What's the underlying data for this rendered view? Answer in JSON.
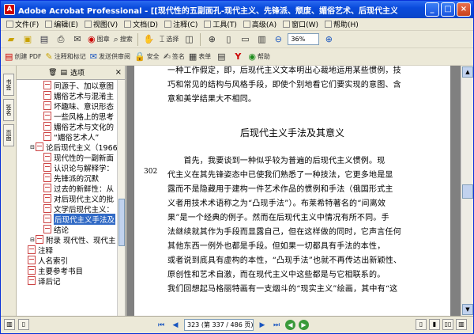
{
  "window": {
    "title": "Adobe Acrobat Professional - [[现代性的五副面孔-现代主义、先锋派、颓废、媚俗艺术、后现代主义].Five.Faces...",
    "min": "_",
    "max": "□",
    "close": "×"
  },
  "menu": [
    "文件(F)",
    "编辑(E)",
    "视图(V)",
    "文档(D)",
    "注释(C)",
    "工具(T)",
    "高级(A)",
    "窗口(W)",
    "帮助(H)"
  ],
  "toolbar1": {
    "find_label": "搜索",
    "read_label": "搜索",
    "zoom": "36%",
    "select_label": "选择"
  },
  "toolbar2": {
    "create_pdf": "创建 PDF",
    "comment_markup": "注释和标记",
    "send_review": "发送供审阅",
    "secure": "安全",
    "sign": "签名",
    "forms": "表单",
    "help": "帮助"
  },
  "nav": {
    "options_label": "选项",
    "left_tabs": [
      "书签",
      "签名",
      "页面"
    ]
  },
  "bookmarks": [
    {
      "label": "同源于、加以意图",
      "indent": 2,
      "sel": false
    },
    {
      "label": "媚俗艺术与混淆主",
      "indent": 2,
      "sel": false
    },
    {
      "label": "坏趣味、意识形态",
      "indent": 2,
      "sel": false
    },
    {
      "label": "一些风格上的思考",
      "indent": 2,
      "sel": false
    },
    {
      "label": "媚俗艺术与文化的",
      "indent": 2,
      "sel": false
    },
    {
      "label": "“媚俗艺术人”",
      "indent": 2,
      "sel": false
    },
    {
      "label": "论后现代主义（1966）",
      "indent": 1,
      "sel": false
    },
    {
      "label": "现代性的一副新面",
      "indent": 2,
      "sel": false
    },
    {
      "label": "认识论与解释学：",
      "indent": 2,
      "sel": false
    },
    {
      "label": "先锋派的沉默",
      "indent": 2,
      "sel": false
    },
    {
      "label": "过去的新鲜性：从",
      "indent": 2,
      "sel": false
    },
    {
      "label": "对后现代主义的批",
      "indent": 2,
      "sel": false
    },
    {
      "label": "文学后现代主义：",
      "indent": 2,
      "sel": false
    },
    {
      "label": "后现代主义手法及",
      "indent": 2,
      "sel": true
    },
    {
      "label": "结论",
      "indent": 2,
      "sel": false
    },
    {
      "label": "附录 现代性、现代主",
      "indent": 1,
      "sel": false
    },
    {
      "label": "注释",
      "indent": 0,
      "sel": false
    },
    {
      "label": "人名索引",
      "indent": 0,
      "sel": false
    },
    {
      "label": "主要参考书目",
      "indent": 0,
      "sel": false
    },
    {
      "label": "译后记",
      "indent": 0,
      "sel": false
    }
  ],
  "page": {
    "top_lines": [
      "一种工作假定，即，后现代主义文本明出心裁地运用某些惯例，技",
      "巧和常见的结构与风格手段，即使个别地看它们要实现的意图、含",
      "意和美学结果大不相同。"
    ],
    "heading": "后现代主义手法及其意义",
    "margin_page_number": "302",
    "body_lines": [
      "　　首先，我要谈到一种似乎较为普遍的后现代主义惯例。现",
      "代主义在其先锋姿态中已使我们熟悉了一种技法，它更多地是显",
      "露而不是隐藏用于建构一件艺术作品的惯例和手法（俄国形式主",
      "义者用技术术语称之为“凸现手法”）。布莱希特著名的“间离效",
      "果”是一个经典的例子。然而在后现代主义中情况有所不同。手",
      "法继续就其作为手段而显露自己，但在这样做的同时，它声言任何",
      "其他东西一例外也都是手段。但如果一切都具有手法的本性，",
      "或者说到底具有虚构的本性，“凸现手法”也就不再传达出新颖性、",
      "原创性和艺术自激，而在现代主义中这些都是与它相联系的。",
      "我们回想起马格丽特画有一支烟斗的“现实主义”绘画，其中有“这"
    ]
  },
  "status": {
    "page_box": "323 (第 337 / 486 页)",
    "first": "⏮",
    "prev": "◀",
    "next": "▶",
    "last": "⏭",
    "back": "◀",
    "fwd": "▶"
  }
}
